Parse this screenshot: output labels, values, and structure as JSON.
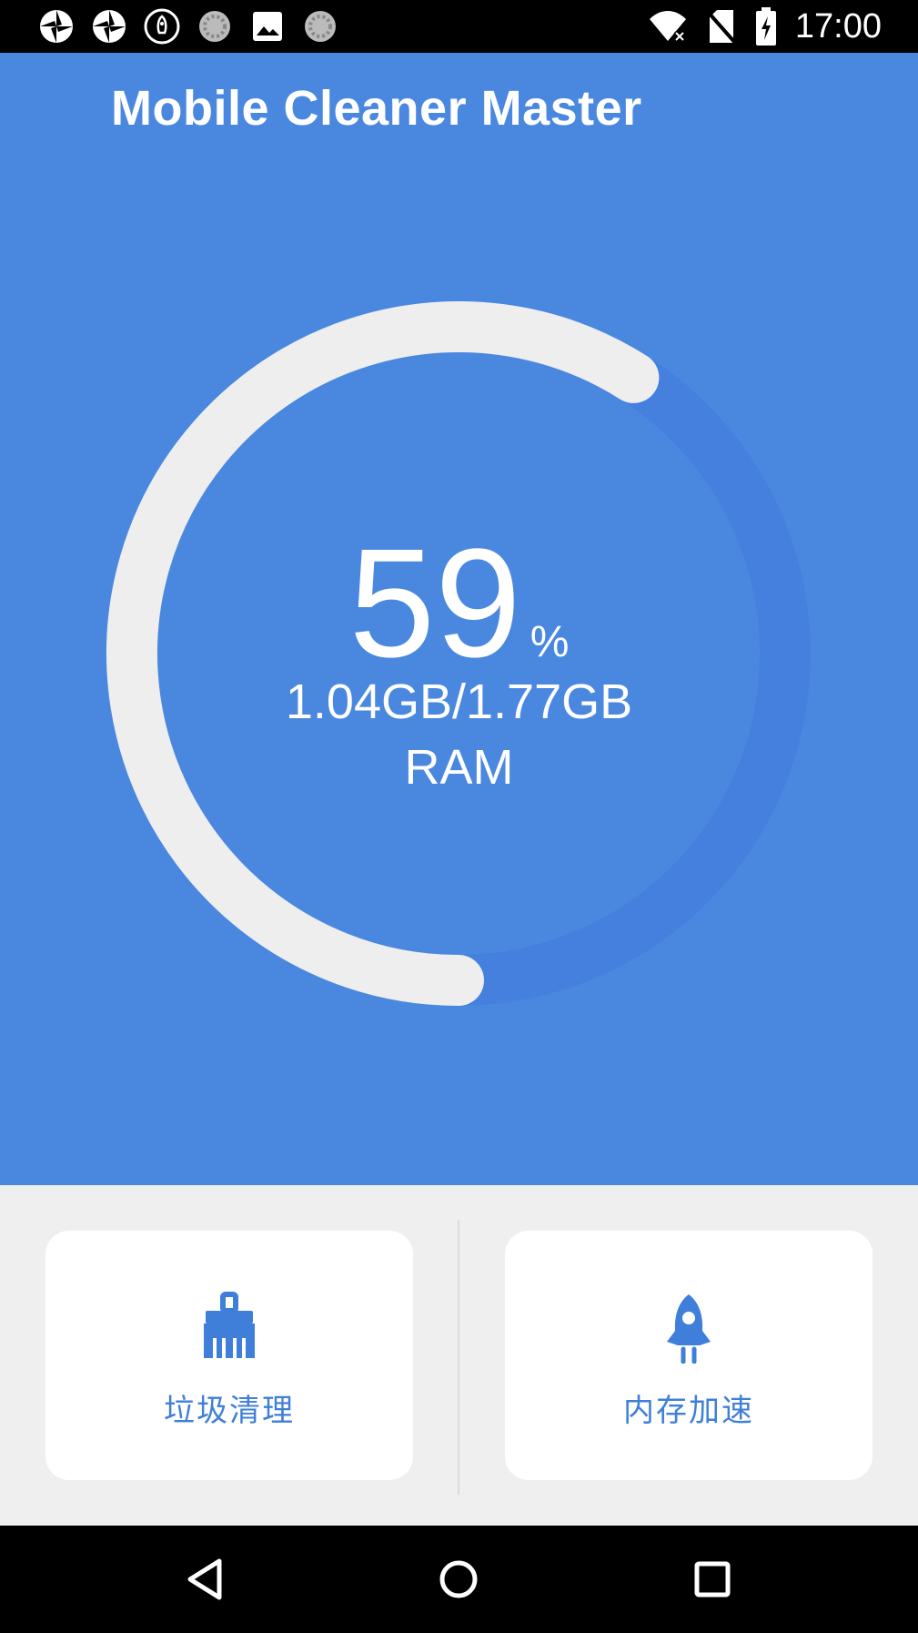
{
  "status_bar": {
    "time": "17:00",
    "left_icons": [
      "aperture-icon",
      "aperture-icon",
      "rocket-badge-icon",
      "spinner-icon",
      "image-icon",
      "spinner-icon"
    ],
    "right_icons": [
      "wifi-off-icon",
      "no-sim-icon",
      "battery-charging-icon"
    ]
  },
  "app": {
    "title": "Mobile Cleaner Master"
  },
  "memory": {
    "usage_percent": 59,
    "percent_unit": "%",
    "used_total": "1.04GB/1.77GB",
    "label": "RAM"
  },
  "actions": {
    "junk_clean": {
      "label": "垃圾清理",
      "icon": "broom-icon"
    },
    "memory_boost": {
      "label": "内存加速",
      "icon": "rocket-icon"
    }
  },
  "colors": {
    "hero_bg": "#4a88df",
    "arc_fill": "#eeeeee",
    "arc_track": "#4580df",
    "accent": "#3f7fd9",
    "panel_bg": "#efefef"
  },
  "nav": {
    "buttons": [
      "back-icon",
      "home-icon",
      "recents-icon"
    ]
  }
}
